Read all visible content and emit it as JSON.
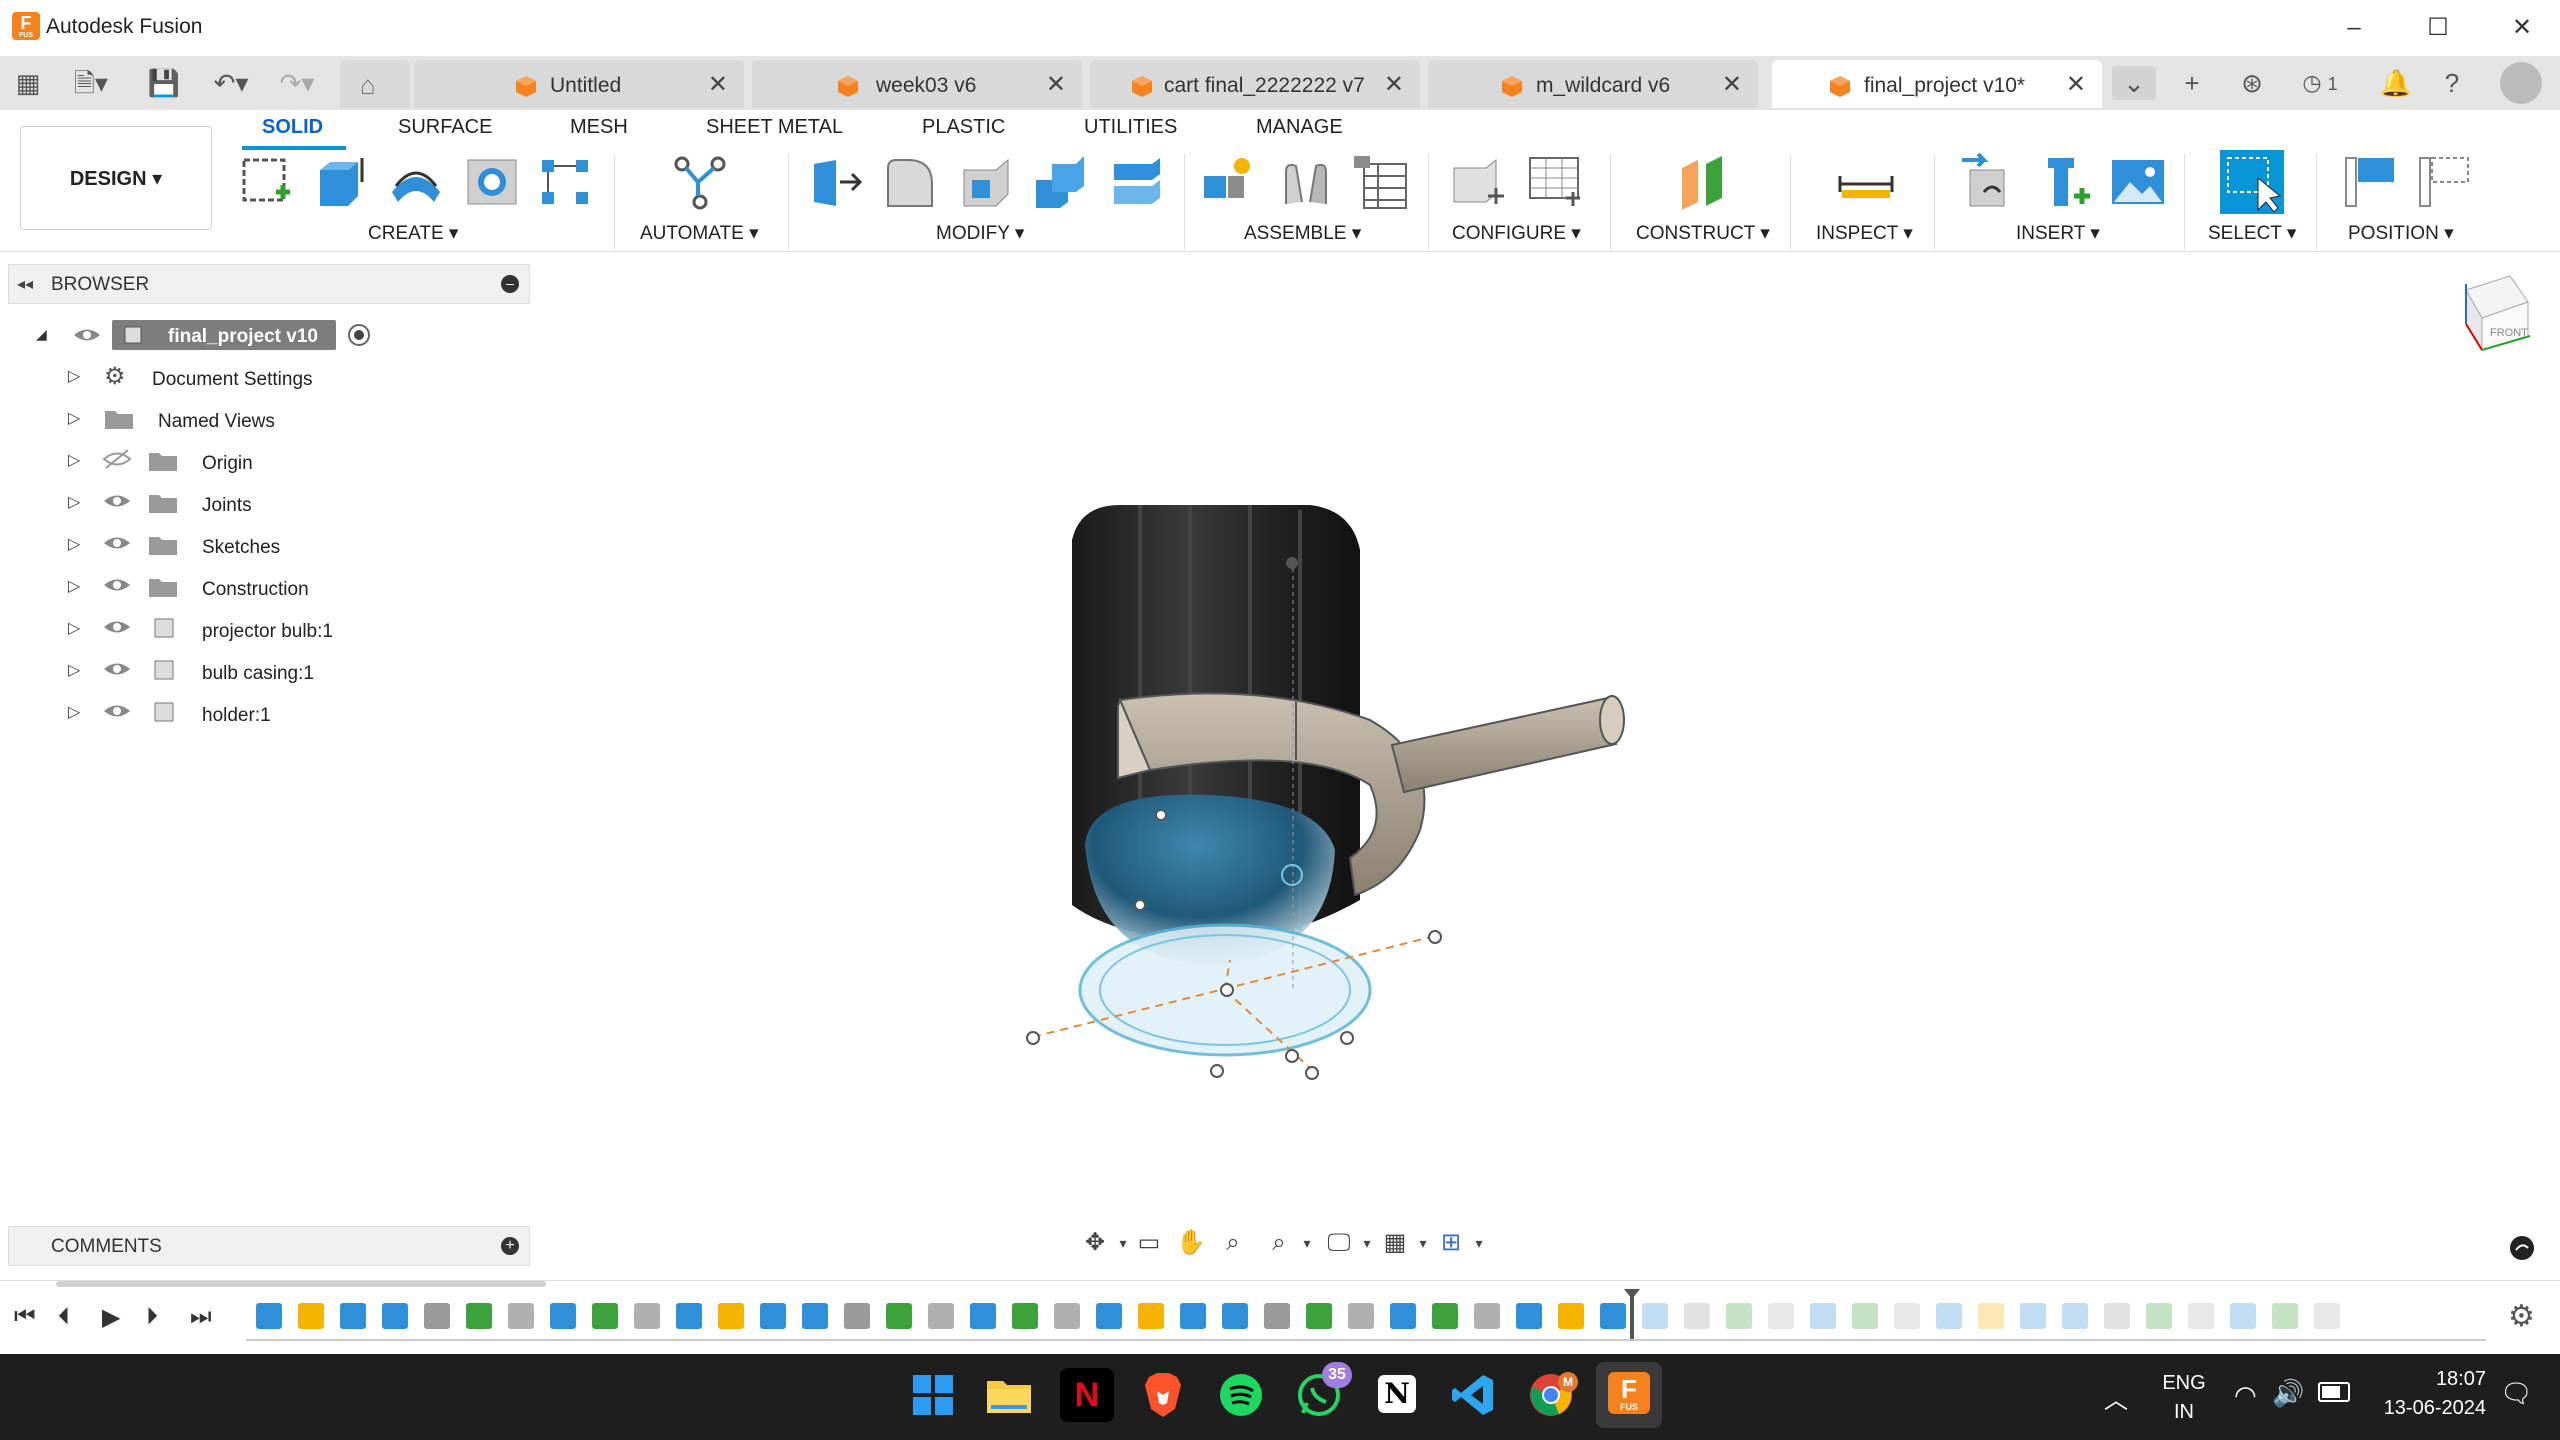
{
  "app": {
    "title": "Autodesk Fusion",
    "logo_letter": "F",
    "logo_sub": "FUS"
  },
  "tabs": [
    {
      "label": "Untitled",
      "active": false
    },
    {
      "label": "week03 v6",
      "active": false
    },
    {
      "label": "cart final_2222222 v7",
      "active": false
    },
    {
      "label": "m_wildcard v6",
      "active": false
    },
    {
      "label": "final_project v10*",
      "active": true
    }
  ],
  "tabbar_right": {
    "jobs_count": "1"
  },
  "workspace": {
    "mode_label": "DESIGN ▾"
  },
  "workspace_tabs": [
    "SOLID",
    "SURFACE",
    "MESH",
    "SHEET METAL",
    "PLASTIC",
    "UTILITIES",
    "MANAGE"
  ],
  "toolbar_groups": [
    "CREATE ▾",
    "AUTOMATE ▾",
    "MODIFY ▾",
    "ASSEMBLE ▾",
    "CONFIGURE ▾",
    "CONSTRUCT ▾",
    "INSPECT ▾",
    "INSERT ▾",
    "SELECT ▾",
    "POSITION ▾"
  ],
  "browser": {
    "title": "BROWSER",
    "root": "final_project v10",
    "items": [
      {
        "label": "Document Settings",
        "icon": "gear-icon"
      },
      {
        "label": "Named Views",
        "icon": "folder-icon"
      },
      {
        "label": "Origin",
        "icon": "folder-icon",
        "hidden": true
      },
      {
        "label": "Joints",
        "icon": "folder-icon"
      },
      {
        "label": "Sketches",
        "icon": "folder-icon"
      },
      {
        "label": "Construction",
        "icon": "folder-icon"
      },
      {
        "label": "projector bulb:1",
        "icon": "component-icon"
      },
      {
        "label": "bulb casing:1",
        "icon": "component-icon"
      },
      {
        "label": "holder:1",
        "icon": "component-icon"
      }
    ]
  },
  "comments": {
    "label": "COMMENTS"
  },
  "viewcube": {
    "face": "FRONT"
  },
  "colors": {
    "accent": "#0696d7",
    "brand_orange": "#f5811f",
    "taskbar": "#1e1e1e"
  },
  "taskbar": {
    "whatsapp_badge": "35",
    "chrome_badge": "M",
    "fusion_label": "F",
    "fusion_sub": "FUS",
    "lang_line1": "ENG",
    "lang_line2": "IN",
    "time": "18:07",
    "date": "13-06-2024"
  }
}
